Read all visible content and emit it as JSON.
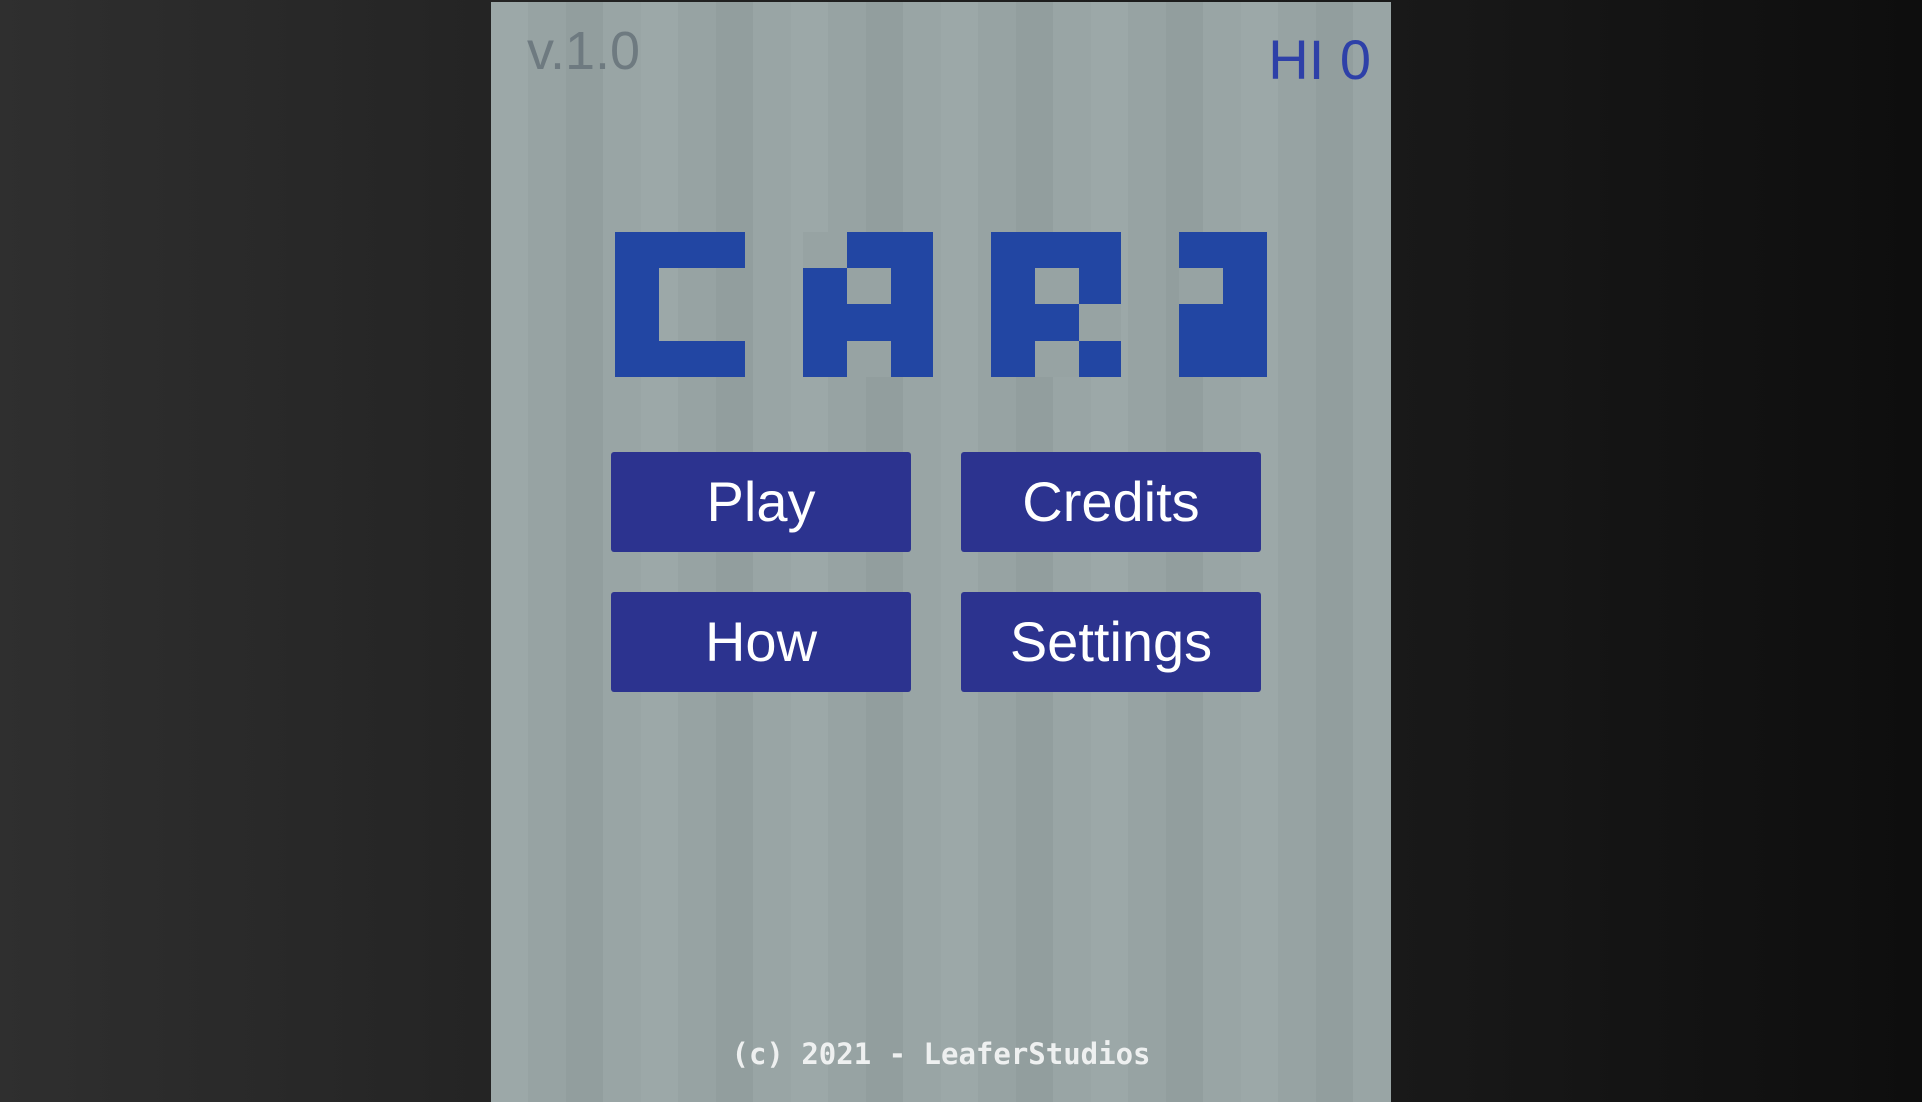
{
  "header": {
    "version": "v.1.0",
    "hiscore": "HI 0"
  },
  "title": {
    "logo_text": "CARS"
  },
  "menu": {
    "play_label": "Play",
    "credits_label": "Credits",
    "how_label": "How",
    "settings_label": "Settings"
  },
  "footer": {
    "copyright": "(c) 2021 - LeaferStudios"
  },
  "colors": {
    "logo": "#2246a3",
    "button_bg": "#2c338f",
    "button_text": "#ffffff",
    "hiscore": "#2e40a8",
    "version": "#6e7a80",
    "screen_bg": "#97a3a3"
  }
}
